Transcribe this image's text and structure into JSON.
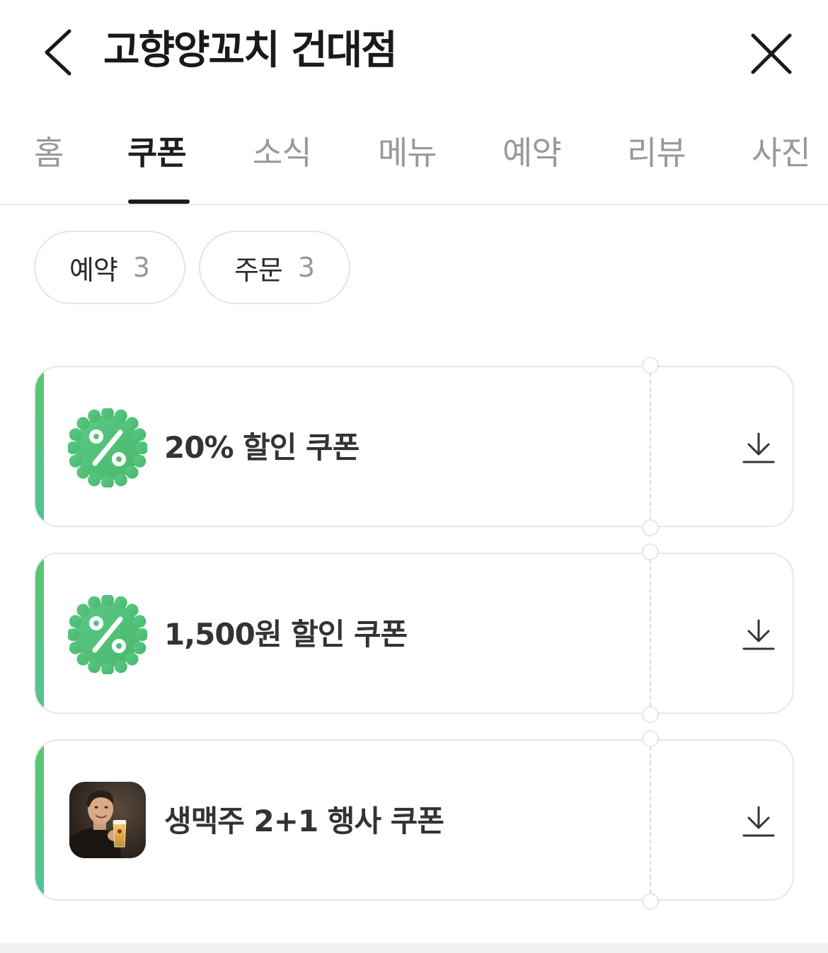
{
  "header": {
    "title": "고향양꼬치 건대점",
    "back_icon": "chevron-left-icon",
    "close_icon": "close-icon"
  },
  "tabs": [
    {
      "label": "홈",
      "active": false
    },
    {
      "label": "쿠폰",
      "active": true
    },
    {
      "label": "소식",
      "active": false
    },
    {
      "label": "메뉴",
      "active": false
    },
    {
      "label": "예약",
      "active": false
    },
    {
      "label": "리뷰",
      "active": false
    },
    {
      "label": "사진",
      "active": false
    }
  ],
  "filters": [
    {
      "label": "예약",
      "count": "3"
    },
    {
      "label": "주문",
      "count": "3"
    }
  ],
  "coupons": [
    {
      "title": "20% 할인 쿠폰",
      "icon": "percent-badge-icon"
    },
    {
      "title": "1,500원 할인 쿠폰",
      "icon": "percent-badge-icon"
    },
    {
      "title": "생맥주 2+1 행사 쿠폰",
      "icon": "beer-promo-thumbnail"
    }
  ],
  "colors": {
    "accent_green": "#57c66b",
    "accent_teal": "#52c39a",
    "text_primary": "#1e1e1e",
    "text_muted": "#999999",
    "border": "#e6e6e6"
  }
}
